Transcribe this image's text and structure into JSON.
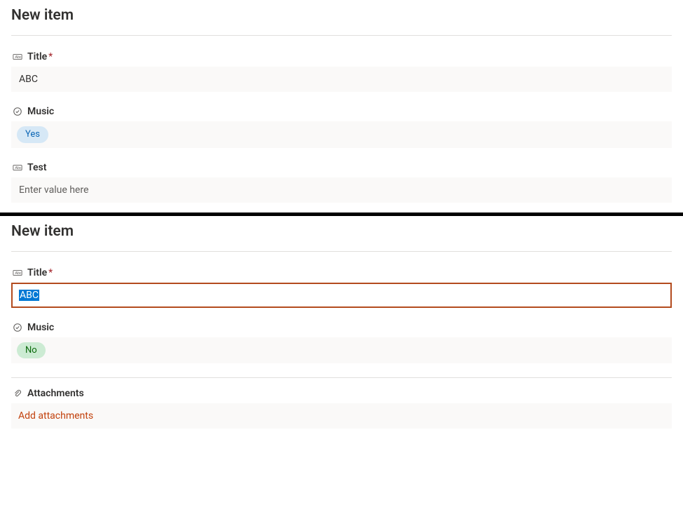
{
  "form1": {
    "header": "New item",
    "fields": {
      "title": {
        "label": "Title",
        "required_mark": "*",
        "value": "ABC"
      },
      "music": {
        "label": "Music",
        "pill_text": "Yes"
      },
      "test": {
        "label": "Test",
        "placeholder": "Enter value here"
      }
    }
  },
  "form2": {
    "header": "New item",
    "fields": {
      "title": {
        "label": "Title",
        "required_mark": "*",
        "value": "ABC"
      },
      "music": {
        "label": "Music",
        "pill_text": "No"
      },
      "attachments": {
        "label": "Attachments",
        "action_text": "Add attachments"
      }
    }
  }
}
